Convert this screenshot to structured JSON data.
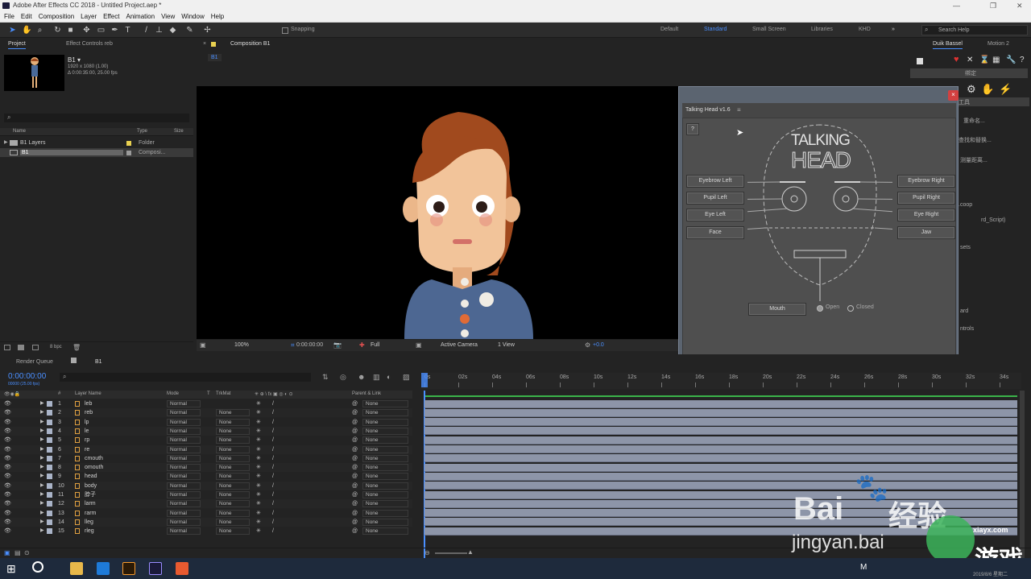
{
  "window": {
    "title": "Adobe After Effects CC 2018 - Untitled Project.aep *"
  },
  "menu": [
    "File",
    "Edit",
    "Composition",
    "Layer",
    "Effect",
    "Animation",
    "View",
    "Window",
    "Help"
  ],
  "toolbar": {
    "snapping": "Snapping",
    "workspaces": [
      "Default",
      "Standard",
      "Small Screen",
      "Libraries",
      "KHD"
    ],
    "active_workspace": "Standard",
    "search_placeholder": "Search Help"
  },
  "project": {
    "tabs": [
      "Project",
      "Effect Controls reb"
    ],
    "item_name": "B1 ▾",
    "item_res": "1920 x 1080 (1.00)",
    "item_dur": "Δ 0:00:35:00, 25.00 fps",
    "search_icon": "⌕",
    "columns": [
      "Name",
      "Type",
      "Size"
    ],
    "items": [
      {
        "name": "B1 Layers",
        "type": "Folder",
        "icon": "folder-icon"
      },
      {
        "name": "B1",
        "type": "Composi...",
        "icon": "comp-icon"
      }
    ],
    "bpc": "8 bpc"
  },
  "viewer": {
    "tab": "Composition B1",
    "comp_label": "B1",
    "zoom": "100%",
    "timecode": "0:00:00:00",
    "resolution": "Full",
    "camera": "Active Camera",
    "view": "1 View",
    "exposure": "+0.0"
  },
  "duik": {
    "tabs": [
      "Duik Bassel",
      "Motion 2"
    ],
    "labels": [
      "绑定",
      "工具",
      "重命名...",
      "查找和替换...",
      "测量距离...",
      ".coop",
      "rd_Script)",
      "sets",
      "ard",
      "ntrols"
    ]
  },
  "talking_head": {
    "title": "Talking Head v1.6",
    "help": "?",
    "logo_top": "TALKING",
    "logo_bottom": "HEAD",
    "left_buttons": [
      "Eyebrow Left",
      "Pupil Left",
      "Eye Left",
      "Face"
    ],
    "right_buttons": [
      "Eyebrow Right",
      "Pupil Right",
      "Eye Right",
      "Jaw"
    ],
    "mouth_button": "Mouth",
    "radio_open": "Open",
    "radio_closed": "Closed",
    "close": "×"
  },
  "timeline": {
    "tabs": [
      "Render Queue",
      "B1"
    ],
    "timecode": "0:00:00:00",
    "timecode_sub": "00000 (25.00 fps)",
    "col_headers": [
      "#",
      "Layer Name",
      "Mode",
      "T",
      "TrkMat",
      "Parent & Link"
    ],
    "ruler": [
      "0s",
      "02s",
      "04s",
      "06s",
      "08s",
      "10s",
      "12s",
      "14s",
      "16s",
      "18s",
      "20s",
      "22s",
      "24s",
      "26s",
      "28s",
      "30s",
      "32s",
      "34s"
    ],
    "layers": [
      {
        "num": "1",
        "name": "leb",
        "mode": "Normal",
        "trkmat": "",
        "parent": "None"
      },
      {
        "num": "2",
        "name": "reb",
        "mode": "Normal",
        "trkmat": "None",
        "parent": "None"
      },
      {
        "num": "3",
        "name": "lp",
        "mode": "Normal",
        "trkmat": "None",
        "parent": "None"
      },
      {
        "num": "4",
        "name": "le",
        "mode": "Normal",
        "trkmat": "None",
        "parent": "None"
      },
      {
        "num": "5",
        "name": "rp",
        "mode": "Normal",
        "trkmat": "None",
        "parent": "None"
      },
      {
        "num": "6",
        "name": "re",
        "mode": "Normal",
        "trkmat": "None",
        "parent": "None"
      },
      {
        "num": "7",
        "name": "cmouth",
        "mode": "Normal",
        "trkmat": "None",
        "parent": "None"
      },
      {
        "num": "8",
        "name": "omouth",
        "mode": "Normal",
        "trkmat": "None",
        "parent": "None"
      },
      {
        "num": "9",
        "name": "head",
        "mode": "Normal",
        "trkmat": "None",
        "parent": "None"
      },
      {
        "num": "10",
        "name": "body",
        "mode": "Normal",
        "trkmat": "None",
        "parent": "None"
      },
      {
        "num": "11",
        "name": "脖子",
        "mode": "Normal",
        "trkmat": "None",
        "parent": "None"
      },
      {
        "num": "12",
        "name": "larm",
        "mode": "Normal",
        "trkmat": "None",
        "parent": "None"
      },
      {
        "num": "13",
        "name": "rarm",
        "mode": "Normal",
        "trkmat": "None",
        "parent": "None"
      },
      {
        "num": "14",
        "name": "lleg",
        "mode": "Normal",
        "trkmat": "None",
        "parent": "None"
      },
      {
        "num": "15",
        "name": "rleg",
        "mode": "Normal",
        "trkmat": "None",
        "parent": "None"
      }
    ]
  },
  "watermark": {
    "brand": "Bai",
    "brand2": "经验",
    "url": "jingyan.bai",
    "site": "xiayx.com",
    "site2": "游戏"
  },
  "taskbar": {
    "lang": "M",
    "date": "2019/8/6 星期二"
  }
}
